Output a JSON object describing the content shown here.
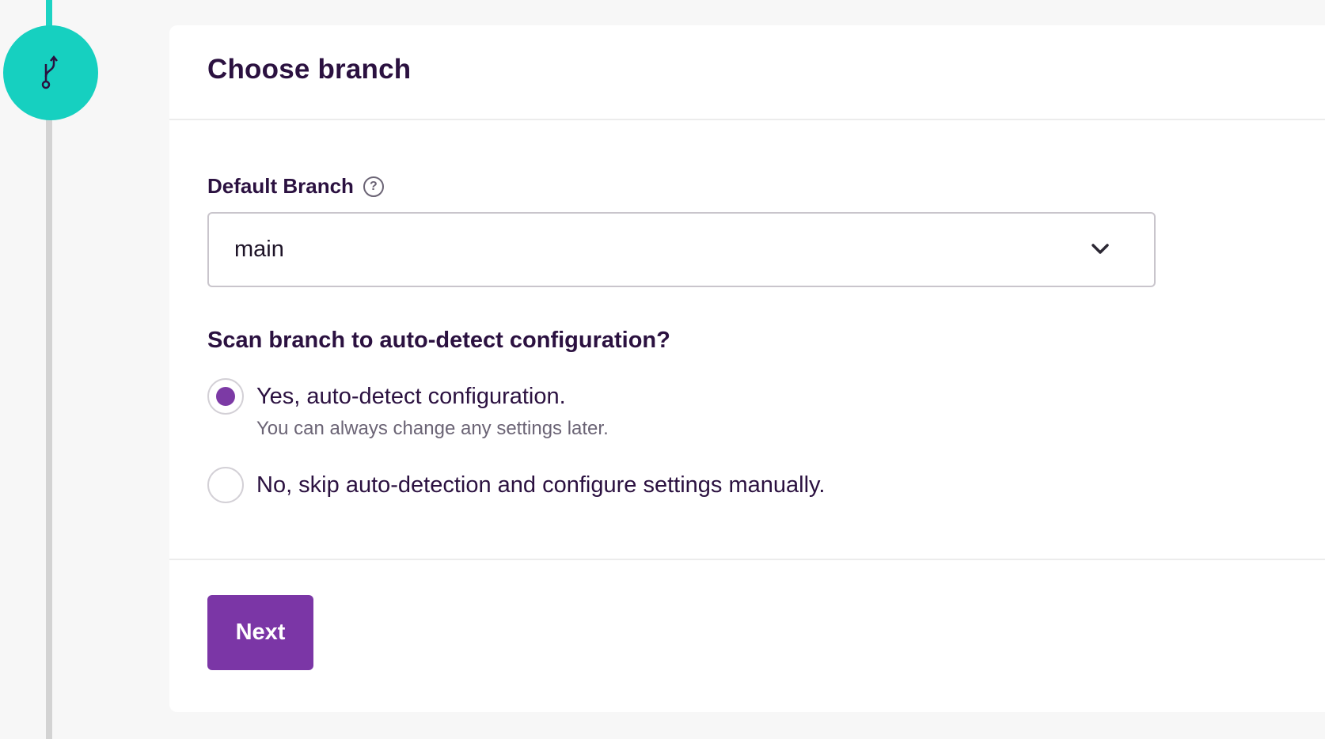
{
  "step": {
    "icon": "git-branch-icon",
    "active_color": "#16d0c0"
  },
  "card": {
    "title": "Choose branch"
  },
  "branch_field": {
    "label": "Default Branch",
    "help_icon": "question-circle-icon",
    "help_glyph": "?",
    "selected_value": "main",
    "chevron_icon": "chevron-down-icon"
  },
  "scan": {
    "question": "Scan branch to auto-detect configuration?",
    "options": [
      {
        "label": "Yes, auto-detect configuration.",
        "hint": "You can always change any settings later.",
        "selected": true
      },
      {
        "label": "No, skip auto-detection and configure settings manually.",
        "selected": false
      }
    ],
    "accent_color": "#7c3aa5"
  },
  "footer": {
    "next_label": "Next"
  }
}
